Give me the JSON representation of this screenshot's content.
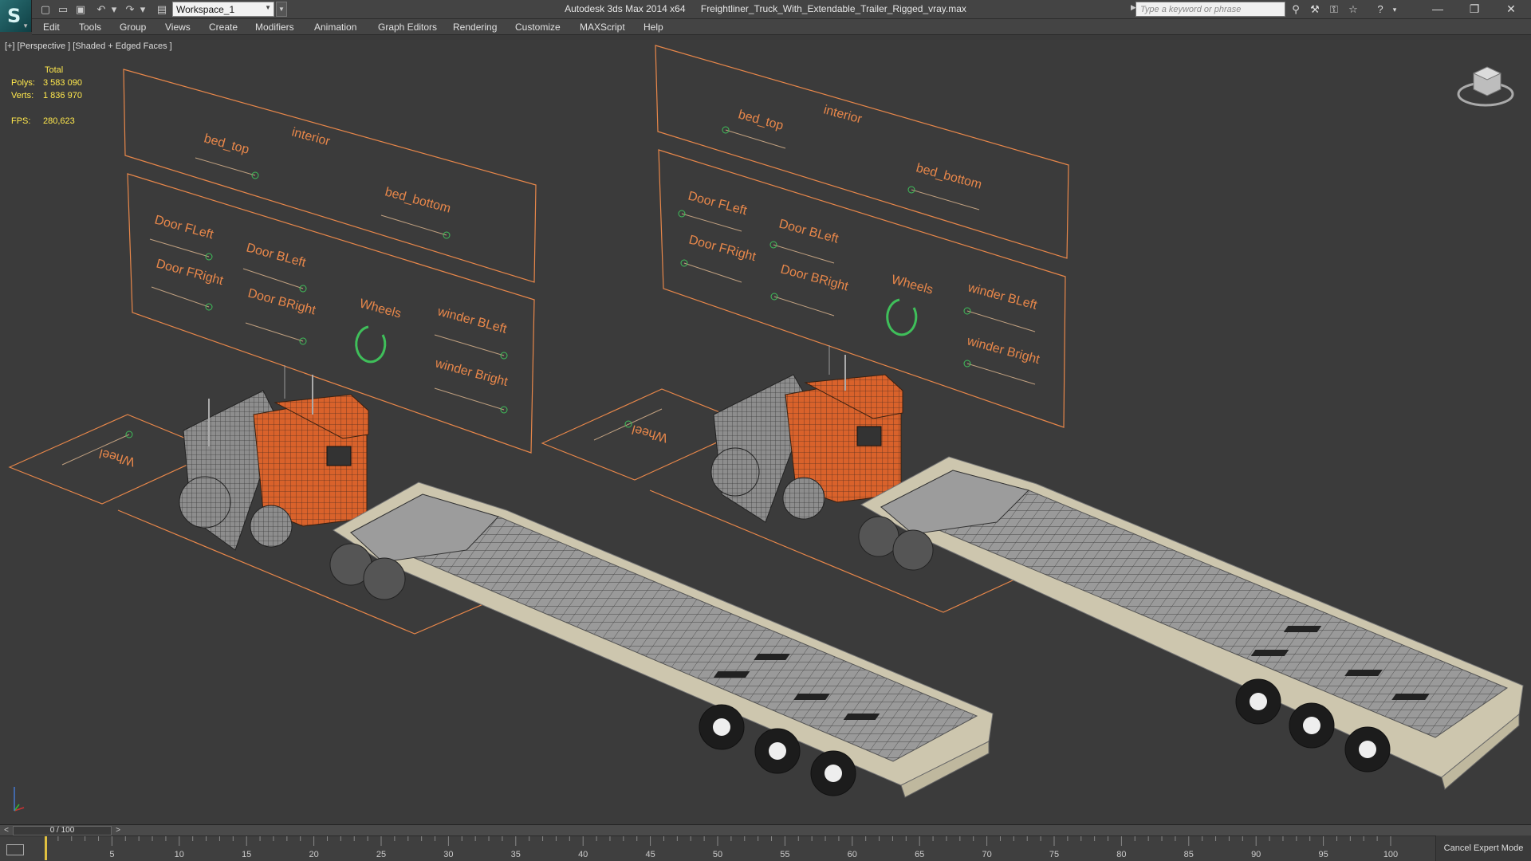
{
  "title": {
    "app": "Autodesk 3ds Max  2014 x64",
    "file": "Freightliner_Truck_With_Extendable_Trailer_Rigged_vray.max"
  },
  "workspace": "Workspace_1",
  "search": {
    "placeholder": "Type a keyword or phrase"
  },
  "menu": [
    "Edit",
    "Tools",
    "Group",
    "Views",
    "Create",
    "Modifiers",
    "Animation",
    "Graph Editors",
    "Rendering",
    "Customize",
    "MAXScript",
    "Help"
  ],
  "viewport": {
    "label": "[+] [Perspective ] [Shaded + Edged Faces ]",
    "stats": {
      "header": "Total",
      "polys_label": "Polys:",
      "polys": "3 583 090",
      "verts_label": "Verts:",
      "verts": "1 836 970",
      "fps_label": "FPS:",
      "fps": "280,623"
    },
    "rig_labels": {
      "bed_top": "bed_top",
      "interior": "interior",
      "bed_bottom": "bed_bottom",
      "door_fleft": "Door FLeft",
      "door_bleft": "Door BLeft",
      "door_fright": "Door FRight",
      "door_bright": "Door BRight",
      "wheels": "Wheels",
      "winder_bleft": "winder BLeft",
      "winder_bright": "winder Bright",
      "wheel": "Wheel"
    }
  },
  "timeline": {
    "slider": "0 / 100",
    "ticks": [
      "0",
      "5",
      "10",
      "15",
      "20",
      "25",
      "30",
      "35",
      "40",
      "45",
      "50",
      "55",
      "60",
      "65",
      "70",
      "75",
      "80",
      "85",
      "90",
      "95",
      "100"
    ]
  },
  "status": {
    "cancel_expert": "Cancel Expert Mode"
  },
  "colors": {
    "rig_orange": "#e8874a",
    "rig_green": "#3fbf5a",
    "stats_yellow": "#ffe84d",
    "cab_orange": "#d9622b"
  }
}
